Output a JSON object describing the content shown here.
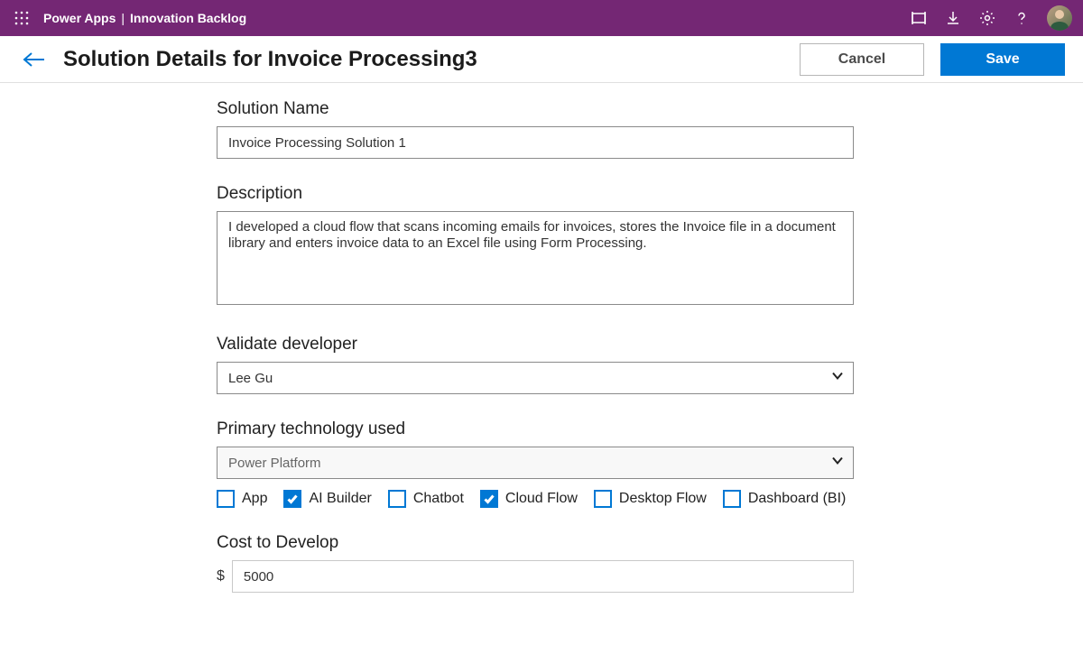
{
  "topbar": {
    "product": "Power Apps",
    "separator": "|",
    "app": "Innovation Backlog"
  },
  "header": {
    "title": "Solution Details for Invoice Processing3",
    "cancel_label": "Cancel",
    "save_label": "Save"
  },
  "form": {
    "solution_name": {
      "label": "Solution Name",
      "value": "Invoice Processing Solution 1"
    },
    "description": {
      "label": "Description",
      "value": "I developed a cloud flow that scans incoming emails for invoices, stores the Invoice file in a document library and enters invoice data to an Excel file using Form Processing."
    },
    "validate_developer": {
      "label": "Validate developer",
      "value": "Lee Gu"
    },
    "primary_technology": {
      "label": "Primary technology used",
      "value": "Power Platform"
    },
    "checkboxes": [
      {
        "label": "App",
        "checked": false
      },
      {
        "label": "AI Builder",
        "checked": true
      },
      {
        "label": "Chatbot",
        "checked": false
      },
      {
        "label": "Cloud Flow",
        "checked": true
      },
      {
        "label": "Desktop Flow",
        "checked": false
      },
      {
        "label": "Dashboard (BI)",
        "checked": false
      }
    ],
    "cost": {
      "label": "Cost to Develop",
      "currency": "$",
      "value": "5000"
    }
  }
}
